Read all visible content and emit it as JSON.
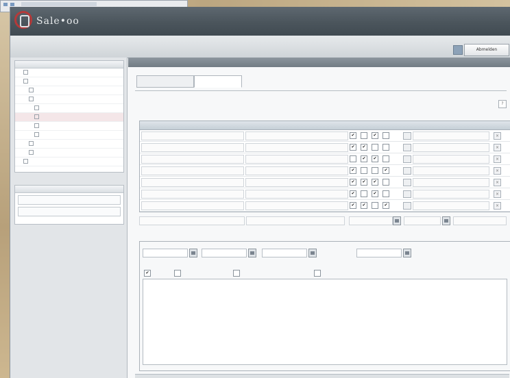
{
  "app": {
    "logo_text": "Sale•oo",
    "logo_sub": ""
  },
  "toolbar": {
    "logout_label": "Abmelden"
  },
  "sidebar": {
    "tree_header": "",
    "tree_items": [
      {
        "label": "",
        "selected": false,
        "indent": 1
      },
      {
        "label": "",
        "selected": false,
        "indent": 1
      },
      {
        "label": "",
        "selected": false,
        "indent": 2
      },
      {
        "label": "",
        "selected": false,
        "indent": 2
      },
      {
        "label": "",
        "selected": false,
        "indent": 3
      },
      {
        "label": "",
        "selected": true,
        "indent": 3
      },
      {
        "label": "",
        "selected": false,
        "indent": 3
      },
      {
        "label": "",
        "selected": false,
        "indent": 3
      },
      {
        "label": "",
        "selected": false,
        "indent": 2
      },
      {
        "label": "",
        "selected": false,
        "indent": 2
      },
      {
        "label": "",
        "selected": false,
        "indent": 1
      }
    ],
    "panel2_header": "",
    "panel2_rows": [
      "",
      ""
    ]
  },
  "main": {
    "bar_title": "",
    "bar_right": "",
    "tabs": [
      "",
      ""
    ],
    "help": "?",
    "section_title": "",
    "grid_headers": [
      "",
      "",
      "",
      ""
    ],
    "rows": [
      {
        "c1": "",
        "c2": "",
        "checks": [
          true,
          false,
          true,
          false
        ],
        "c3": ""
      },
      {
        "c1": "",
        "c2": "",
        "checks": [
          true,
          true,
          false,
          false
        ],
        "c3": ""
      },
      {
        "c1": "",
        "c2": "",
        "checks": [
          false,
          true,
          true,
          false
        ],
        "c3": ""
      },
      {
        "c1": "",
        "c2": "",
        "checks": [
          true,
          false,
          false,
          true
        ],
        "c3": ""
      },
      {
        "c1": "",
        "c2": "",
        "checks": [
          true,
          true,
          true,
          false
        ],
        "c3": ""
      },
      {
        "c1": "",
        "c2": "",
        "checks": [
          true,
          false,
          true,
          false
        ],
        "c3": ""
      },
      {
        "c1": "",
        "c2": "",
        "checks": [
          true,
          true,
          false,
          true
        ],
        "c3": ""
      }
    ],
    "footer_fields": {
      "left_value": "",
      "mid_value": "",
      "right_value": "",
      "row2_label1": "",
      "row2_label2": "",
      "row2_label3": "",
      "row2_label4": ""
    },
    "fieldset": {
      "legend": "",
      "option_labels": [
        "",
        "",
        "",
        ""
      ],
      "check_labels": [
        "",
        "",
        "",
        ""
      ]
    },
    "bottom_link": ""
  }
}
